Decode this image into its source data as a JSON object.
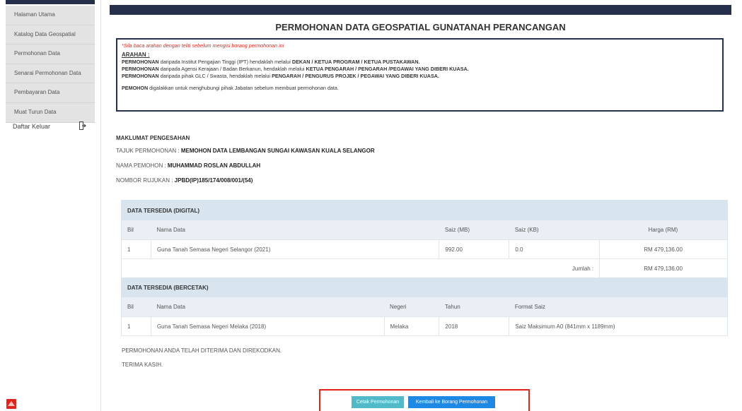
{
  "sidebar": {
    "items": [
      {
        "label": "Halaman Utama"
      },
      {
        "label": "Katalog Data Geospatial"
      },
      {
        "label": "Permohonan Data"
      },
      {
        "label": "Senarai Permohonan Data"
      },
      {
        "label": "Pembayaran Data"
      },
      {
        "label": "Muat Turun Data"
      }
    ],
    "logout_label": "Daftar Keluar"
  },
  "page": {
    "title": "PERMOHONAN DATA GEOSPATIAL GUNATANAH PERANCANGAN"
  },
  "arahan": {
    "note": "*Sila baca arahan dengan teliti sebelum mengisi borang permohonan ini",
    "title": "ARAHAN :",
    "lines": [
      {
        "bold": "PERMOHONAN",
        "text": " daripada Institut Pengajian Tinggi (IPT) hendaklah melalui ",
        "bold2": "DEKAN / KETUA PROGRAM / KETUA PUSTAKAWAN."
      },
      {
        "bold": "PERMOHONAN",
        "text": " daripada Agensi Kerajaan / Badan Berkanun, hendaklah melalui ",
        "bold2": "KETUA PENGARAH / PENGARAH /PEGAWAI YANG DIBERI KUASA."
      },
      {
        "bold": "PERMOHONAN",
        "text": " daripada pihak GLC / Swasta, hendaklah melalui ",
        "bold2": "PENGARAH / PENGURUS PROJEK / PEGAWAI YANG DIBERI KUASA."
      }
    ],
    "pemohon_bold": "PEMOHON",
    "pemohon_text": " digalakkan untuk menghubungi pihak Jabatan sebelum membuat permohonan data."
  },
  "maklumat": {
    "title": "MAKLUMAT PENGESAHAN",
    "tajuk_label": "TAJUK PERMOHONAN : ",
    "tajuk_value": "MEMOHON DATA LEMBANGAN SUNGAI KAWASAN KUALA SELANGOR",
    "nama_label": "NAMA PEMOHON : ",
    "nama_value": "MUHAMMAD ROSLAN ABDULLAH",
    "rujukan_label": "NOMBOR RUJUKAN : ",
    "rujukan_value": "JPBD(IP)185/174/008/001/(54)"
  },
  "digital": {
    "section_title": "DATA TERSEDIA (DIGITAL)",
    "headers": {
      "bil": "Bil",
      "nama": "Nama Data",
      "saiz_mb": "Saiz (MB)",
      "saiz_kb": "Saiz (KB)",
      "harga": "Harga (RM)"
    },
    "row": {
      "bil": "1",
      "nama": "Guna Tanah Semasa Negeri Selangor (2021)",
      "saiz_mb": "992.00",
      "saiz_kb": "0.0",
      "harga": "RM 479,136.00"
    },
    "jumlah_label": "Jumlah :",
    "jumlah_value": "RM 479,136.00"
  },
  "bercetak": {
    "section_title": "DATA TERSEDIA (BERCETAK)",
    "headers": {
      "bil": "Bil",
      "nama": "Nama Data",
      "negeri": "Negeri",
      "tahun": "Tahun",
      "format": "Format Saiz"
    },
    "row": {
      "bil": "1",
      "nama": "Guna Tanah Semasa Negeri Melaka (2018)",
      "negeri": "Melaka",
      "tahun": "2018",
      "format": "Saiz Maksimum A0 (841mm x 1189mm)"
    }
  },
  "footer": {
    "line1": "PERMOHONAN ANDA TELAH DITERIMA DAN DIREKODKAN.",
    "line2": "TERIMA KASIH."
  },
  "buttons": {
    "cetak": "Cetak Permohonan",
    "kembali": "Kembali ke Borang Permohonan"
  },
  "colors": {
    "navy": "#26304a",
    "cetak_btn": "#52b9c8",
    "kembali_btn": "#1e88e5",
    "highlight_red": "#e2231a"
  }
}
